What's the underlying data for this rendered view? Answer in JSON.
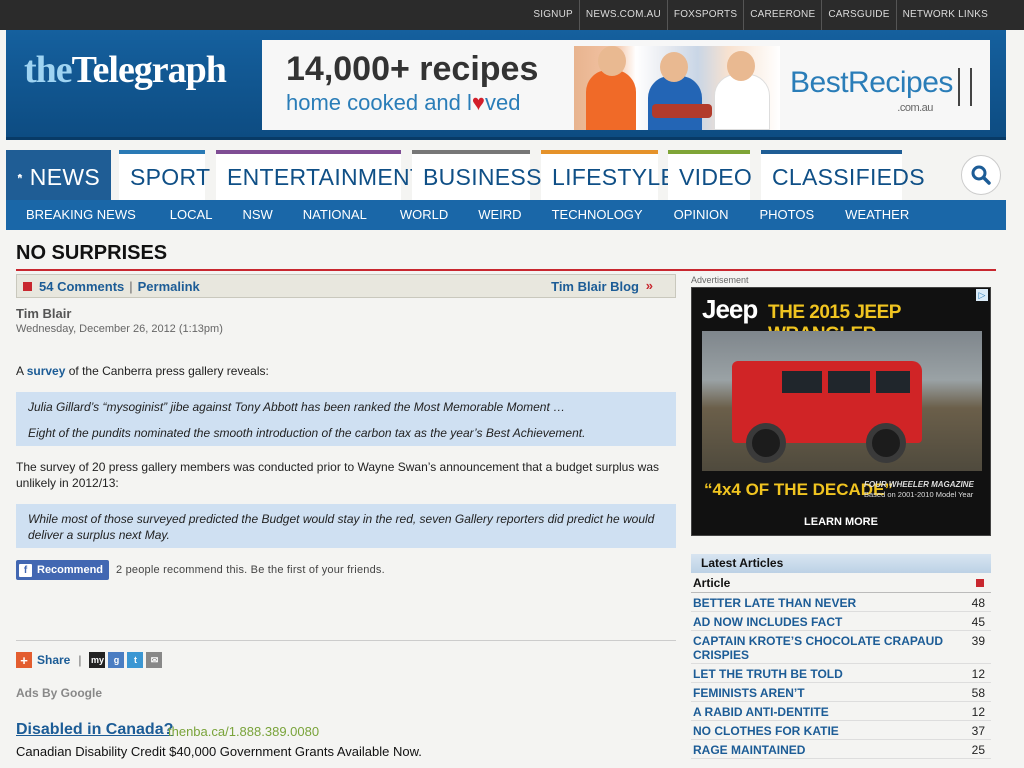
{
  "topbar": {
    "links": [
      "SIGNUP",
      "NEWS.COM.AU",
      "FOXSPORTS",
      "CAREERONE",
      "CARSGUIDE",
      "NETWORK LINKS"
    ]
  },
  "logo": {
    "the": "the",
    "name": "Telegraph"
  },
  "banner": {
    "line1": "14,000+ recipes",
    "line2a": "home cooked and l",
    "heart": "♥",
    "line2b": "ved",
    "brand": "BestRecipes",
    "brand_sub": ".com.au"
  },
  "nav": {
    "tabs": [
      "NEWS",
      "SPORT",
      "ENTERTAINMENT",
      "BUSINESS",
      "LIFESTYLE",
      "VIDEO",
      "CLASSIFIEDS"
    ],
    "tab_colors": [
      "#1f5d95",
      "#2a7ab5",
      "#7f4d94",
      "#777777",
      "#e5922a",
      "#7fa537",
      "#1f5d95"
    ],
    "sub": [
      "BREAKING NEWS",
      "LOCAL",
      "NSW",
      "NATIONAL",
      "WORLD",
      "WEIRD",
      "TECHNOLOGY",
      "OPINION",
      "PHOTOS",
      "WEATHER"
    ]
  },
  "article": {
    "title": "NO SURPRISES",
    "comments": "54 Comments",
    "separator": "|",
    "permalink": "Permalink",
    "blog_link": "Tim Blair Blog",
    "blog_chev": "»",
    "author": "Tim Blair",
    "date": "Wednesday, December 26, 2012 (1:13pm)",
    "p1_a": "A ",
    "p1_link": "survey",
    "p1_b": " of the Canberra press gallery reveals:",
    "q1": "Julia Gillard’s “mysoginist” jibe against Tony Abbott has been ranked the Most Memorable Moment …",
    "q2": "Eight of the pundits nominated the smooth introduction of the carbon tax as the year’s Best Achievement.",
    "p2": "The survey of 20 press gallery members was conducted prior to Wayne Swan’s announcement that a budget surplus was unlikely in 2012/13:",
    "q3": "While most of those surveyed predicted the Budget would stay in the red, seven Gallery reporters did predict he would deliver a surplus next May.",
    "recommend": "Recommend",
    "recommend_text": "2 people recommend this. Be the first of your friends.",
    "share": "Share",
    "share_sep": "|",
    "share_icons": [
      "my",
      "g",
      "t",
      "✉"
    ]
  },
  "ads": {
    "label": "Ads By Google",
    "title": "Disabled in Canada?",
    "url": "thenba.ca/1.888.389.0080",
    "desc": "Canadian Disability Credit $40,000 Government Grants Available Now."
  },
  "sidebar": {
    "ad_label": "Advertisement",
    "jeep_brand": "Jeep",
    "jeep_headline": "THE 2015 JEEP WRANGLER",
    "jeep_slogan": "“4x4 OF THE DECADE”",
    "jeep_mag": "FOUR WHEELER MAGAZINE",
    "jeep_mag_sub": "Based on 2001-2010 Model Year",
    "jeep_cta": "LEARN MORE",
    "adchoice": "▷",
    "latest_title": "Latest Articles",
    "col_article": "Article",
    "articles": [
      {
        "title": "BETTER LATE THAN NEVER",
        "count": "48"
      },
      {
        "title": "AD NOW INCLUDES FACT",
        "count": "45"
      },
      {
        "title": "CAPTAIN KROTE’S CHOCOLATE CRAPAUD CRISPIES",
        "count": "39"
      },
      {
        "title": "LET THE TRUTH BE TOLD",
        "count": "12"
      },
      {
        "title": "FEMINISTS AREN’T",
        "count": "58"
      },
      {
        "title": "A RABID ANTI-DENTITE",
        "count": "12"
      },
      {
        "title": "NO CLOTHES FOR KATIE",
        "count": "37"
      },
      {
        "title": "RAGE MAINTAINED",
        "count": "25"
      }
    ]
  }
}
